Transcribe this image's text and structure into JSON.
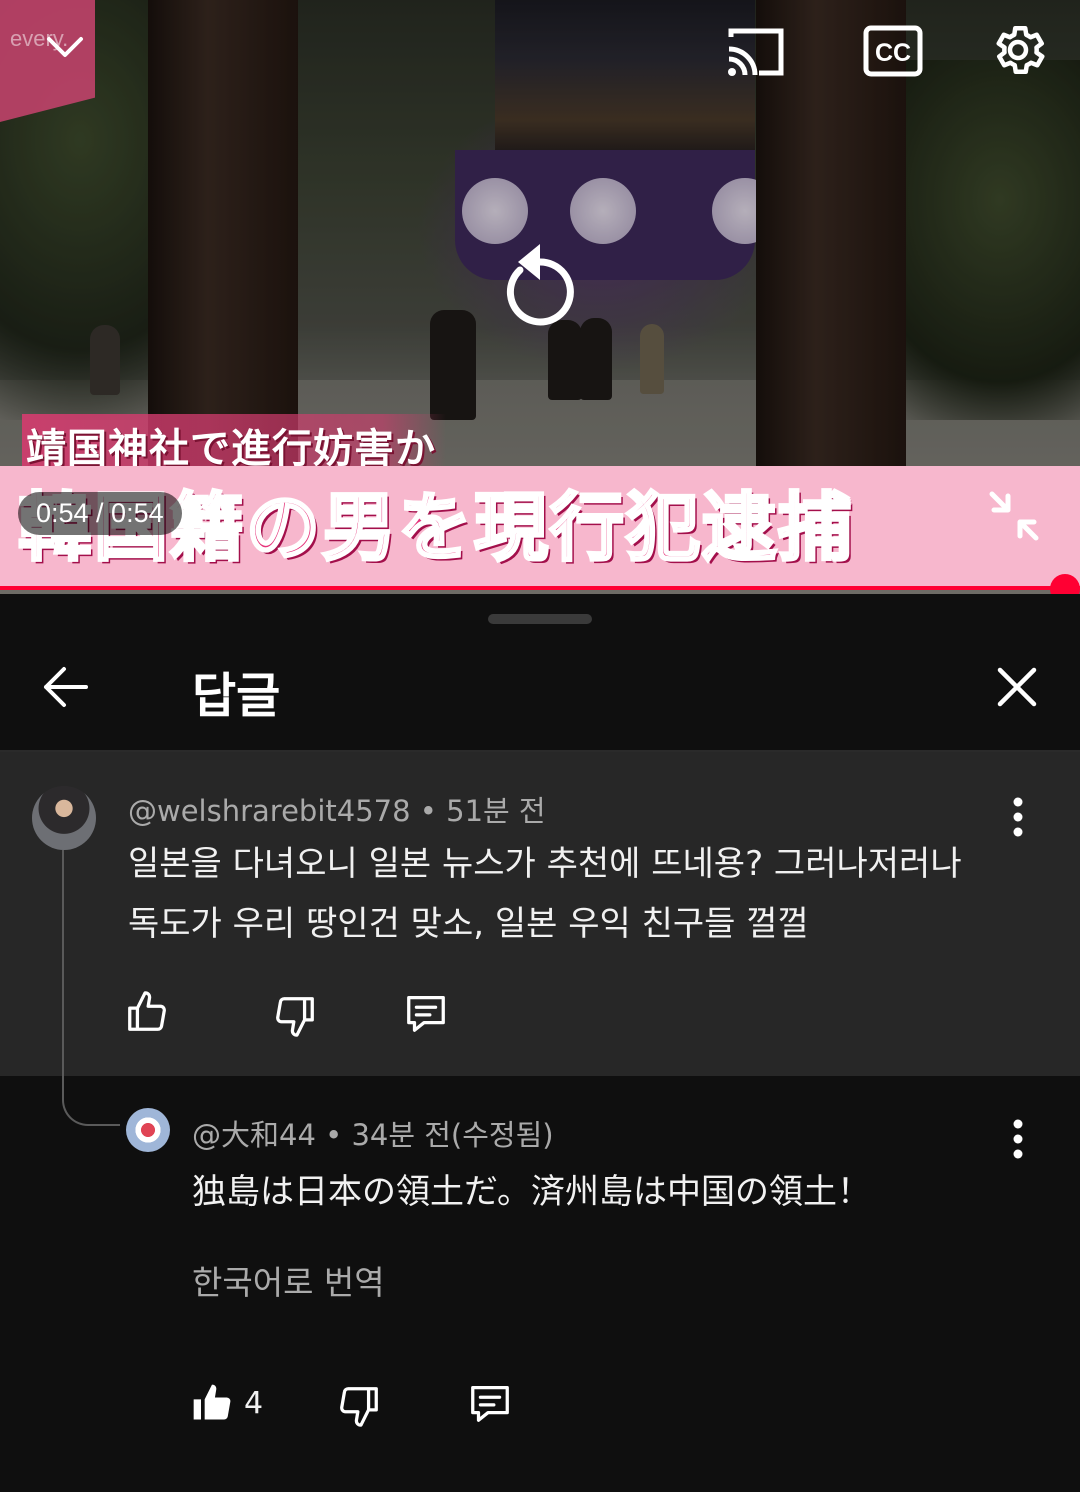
{
  "player": {
    "channel_logo": "every.",
    "caption_top": "靖国神社で進行妨害か",
    "caption_main": "韓国籍の男を現行犯逮捕",
    "time": "0:54 / 0:54",
    "progress": 1.0,
    "icons": [
      "chevron-down-icon",
      "cast-icon",
      "cc-icon",
      "settings-icon",
      "replay-icon",
      "fullscreen-exit-icon"
    ]
  },
  "panel": {
    "title": "답글"
  },
  "comments": [
    {
      "author": "@welshrarebit4578",
      "time": "51분 전",
      "text_line1": "일본을 다녀오니 일본 뉴스가 추천에 뜨네용? 그러나저러나",
      "text_line2": "독도가 우리 땅인건 맞소, 일본 우익 친구들 껄껄"
    },
    {
      "author": "@大和44",
      "time": "34분 전(수정됨)",
      "text": "独島は日本の領土だ。済州島は中国の領土！",
      "translate_label": "한국어로 번역",
      "likes": "4"
    }
  ],
  "colors": {
    "progress": "#ff0033",
    "caption_pink": "#e5337a",
    "panel_bg": "#0f0f0f",
    "highlight_bg": "#272727"
  }
}
